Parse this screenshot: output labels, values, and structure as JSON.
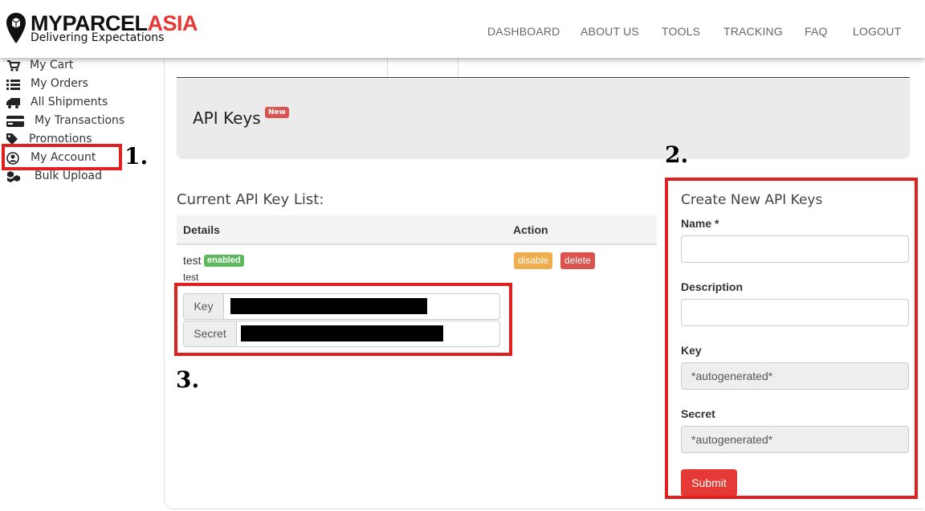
{
  "header": {
    "logo": {
      "title_dark": "MYPARCEL",
      "title_red": "ASIA",
      "tagline": "Delivering Expectations"
    },
    "nav": [
      "DASHBOARD",
      "ABOUT US",
      "TOOLS",
      "TRACKING",
      "FAQ",
      "LOGOUT"
    ]
  },
  "sidebar": {
    "items": [
      {
        "label": "My Cart",
        "icon": "cart-icon"
      },
      {
        "label": "My Orders",
        "icon": "list-icon"
      },
      {
        "label": "All Shipments",
        "icon": "truck-icon"
      },
      {
        "label": "My Transactions",
        "icon": "credit-card-icon"
      },
      {
        "label": "Promotions",
        "icon": "tag-icon"
      },
      {
        "label": "My Account",
        "icon": "user-circle-icon"
      },
      {
        "label": "Bulk Upload",
        "icon": "boxes-icon"
      }
    ]
  },
  "callouts": [
    "1.",
    "2.",
    "3."
  ],
  "page": {
    "title": "API Keys",
    "new_badge": "New"
  },
  "api_list": {
    "title": "Current API Key List:",
    "columns": [
      "Details",
      "Action"
    ],
    "rows": [
      {
        "name": "test",
        "status": "enabled",
        "description": "test",
        "key_label": "Key",
        "secret_label": "Secret",
        "actions": [
          "disable",
          "delete"
        ]
      }
    ]
  },
  "create_form": {
    "title": "Create New API Keys",
    "name_label": "Name *",
    "description_label": "Description",
    "key_label": "Key",
    "key_value": "*autogenerated*",
    "secret_label": "Secret",
    "secret_value": "*autogenerated*",
    "submit": "Submit"
  },
  "colors": {
    "brand_red": "#e53935",
    "highlight_red": "#e0201f",
    "success": "#5cb85c",
    "warning": "#f0ad4e",
    "danger": "#d9534f"
  }
}
